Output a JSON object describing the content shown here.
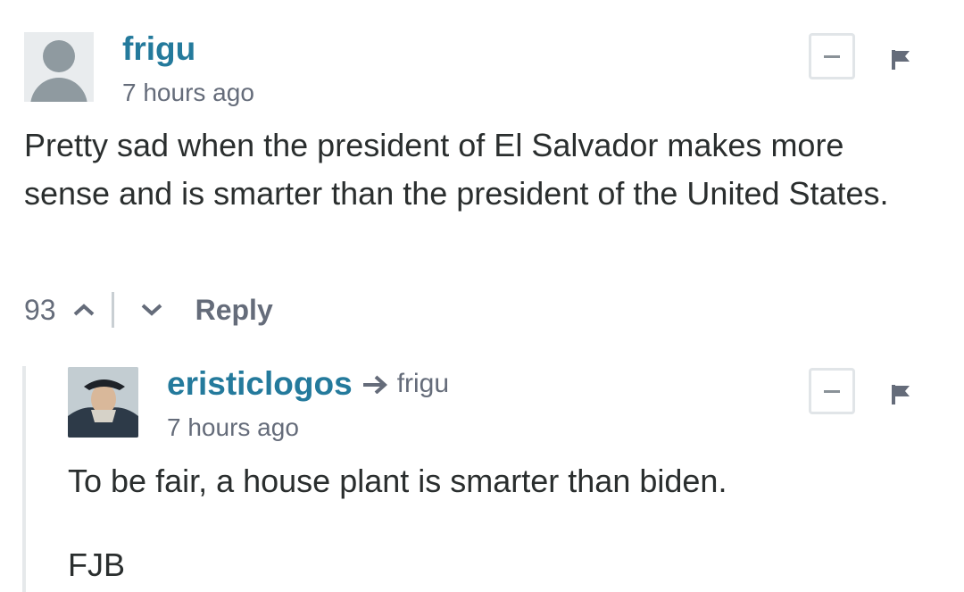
{
  "comments": [
    {
      "author": "frigu",
      "time": "7 hours ago",
      "text": "Pretty sad when the president of El Salvador makes more sense and is smarter than the president of the United States.",
      "votes": "93",
      "reply_label": "Reply",
      "avatar_icon": "default-avatar-icon"
    },
    {
      "author": "eristiclogos",
      "reply_to": "frigu",
      "time": "7 hours ago",
      "text_line1": "To be fair, a house plant is smarter than biden.",
      "text_line2": "FJB",
      "avatar_icon": "portrait-avatar"
    }
  ],
  "colors": {
    "author": "#247a9c",
    "meta": "#656c7a",
    "text": "#2a2e2e",
    "thread_line": "#e6e9eb"
  }
}
